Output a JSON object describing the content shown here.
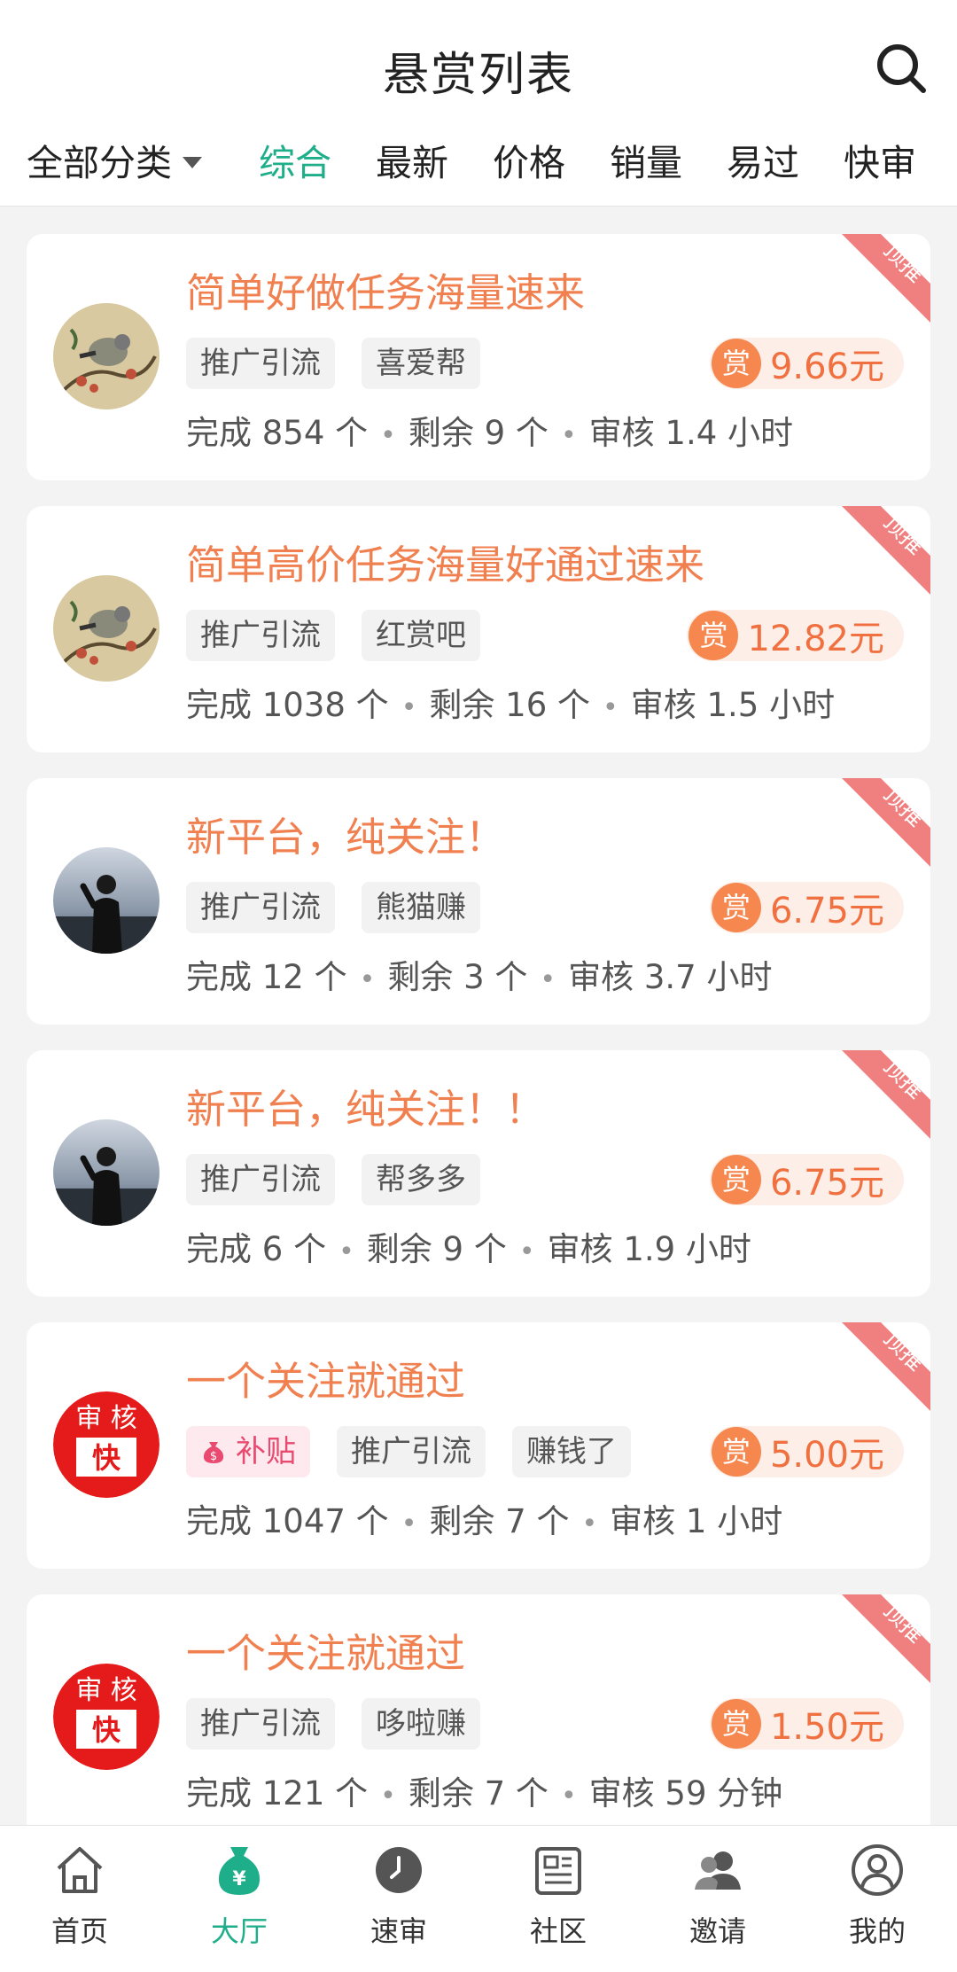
{
  "header": {
    "title": "悬赏列表",
    "filter_label": "全部分类",
    "tabs": [
      {
        "label": "综合",
        "active": true
      },
      {
        "label": "最新",
        "active": false
      },
      {
        "label": "价格",
        "active": false
      },
      {
        "label": "销量",
        "active": false
      },
      {
        "label": "易过",
        "active": false
      },
      {
        "label": "快审",
        "active": false
      }
    ]
  },
  "cards": [
    {
      "title": "简单好做任务海量速来",
      "avatar": "bird",
      "subsidy": null,
      "tags": [
        "推广引流",
        "喜爱帮"
      ],
      "reward_badge": "赏",
      "reward": "9.66元",
      "stats": [
        "完成 854 个",
        "剩余 9 个",
        "审核 1.4 小时"
      ],
      "ribbon": "顶推"
    },
    {
      "title": "简单高价任务海量好通过速来",
      "avatar": "bird",
      "subsidy": null,
      "tags": [
        "推广引流",
        "红赏吧"
      ],
      "reward_badge": "赏",
      "reward": "12.82元",
      "stats": [
        "完成 1038 个",
        "剩余 16 个",
        "审核 1.5 小时"
      ],
      "ribbon": "顶推"
    },
    {
      "title": "新平台，纯关注！",
      "avatar": "person",
      "subsidy": null,
      "tags": [
        "推广引流",
        "熊猫赚"
      ],
      "reward_badge": "赏",
      "reward": "6.75元",
      "stats": [
        "完成 12 个",
        "剩余 3 个",
        "审核 3.7 小时"
      ],
      "ribbon": "顶推"
    },
    {
      "title": "新平台，纯关注！！",
      "avatar": "person",
      "subsidy": null,
      "tags": [
        "推广引流",
        "帮多多"
      ],
      "reward_badge": "赏",
      "reward": "6.75元",
      "stats": [
        "完成 6 个",
        "剩余 9 个",
        "审核 1.9 小时"
      ],
      "ribbon": "顶推"
    },
    {
      "title": "一个关注就通过",
      "avatar": "kuai",
      "avatar_text": [
        "审 核",
        "快"
      ],
      "subsidy": "补贴",
      "tags": [
        "推广引流",
        "赚钱了"
      ],
      "reward_badge": "赏",
      "reward": "5.00元",
      "stats": [
        "完成 1047 个",
        "剩余 7 个",
        "审核 1 小时"
      ],
      "ribbon": "顶推"
    },
    {
      "title": "一个关注就通过",
      "avatar": "kuai",
      "avatar_text": [
        "审 核",
        "快"
      ],
      "subsidy": null,
      "tags": [
        "推广引流",
        "哆啦赚"
      ],
      "reward_badge": "赏",
      "reward": "1.50元",
      "stats": [
        "完成 121 个",
        "剩余 7 个",
        "审核 59 分钟"
      ],
      "ribbon": "顶推"
    }
  ],
  "nav": [
    {
      "label": "首页",
      "icon": "home-icon",
      "active": false
    },
    {
      "label": "大厅",
      "icon": "money-bag-icon",
      "active": true
    },
    {
      "label": "速审",
      "icon": "clock-icon",
      "active": false
    },
    {
      "label": "社区",
      "icon": "newspaper-icon",
      "active": false
    },
    {
      "label": "邀请",
      "icon": "users-icon",
      "active": false
    },
    {
      "label": "我的",
      "icon": "profile-icon",
      "active": false
    }
  ],
  "colors": {
    "accent": "#1fae8a",
    "title_orange": "#f08050",
    "reward_badge": "#f5874f",
    "ribbon": "#f08080"
  }
}
